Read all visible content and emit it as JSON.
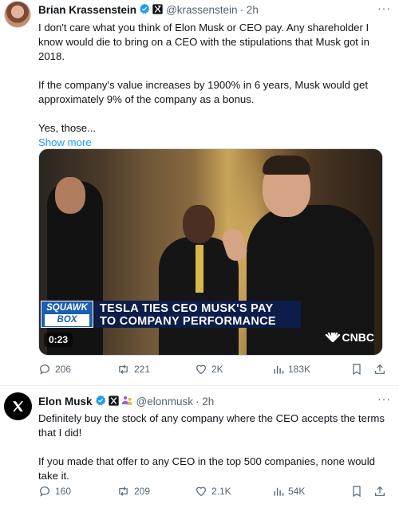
{
  "tweet1": {
    "name": "Brian Krassenstein",
    "handle": "@krassenstein",
    "time": "· 2h",
    "more": "···",
    "paragraphs": [
      "I don't care what you think of Elon Musk or CEO pay. Any shareholder I know would die to bring on a CEO with the stipulations that Musk got in 2018.",
      "If the company's value increases by 1900% in 6 years, Musk would get approximately 9% of the company as a bonus.",
      "Yes, those..."
    ],
    "show_more": "Show more",
    "video": {
      "duration": "0:23",
      "squawk_line1": "SQUAWK",
      "squawk_line2": "BOX",
      "headline_line1": "TESLA TIES CEO MUSK'S PAY",
      "headline_line2": "TO COMPANY PERFORMANCE",
      "network": "CNBC"
    },
    "stats": {
      "replies": "206",
      "reposts": "221",
      "likes": "2K",
      "views": "183K"
    }
  },
  "tweet2": {
    "name": "Elon Musk",
    "handle": "@elonmusk",
    "time": "· 2h",
    "more": "···",
    "paragraphs": [
      "Definitely buy the stock of any company where the CEO accepts the terms that I did!",
      "If you made that offer to any CEO in the top 500 companies, none would take it."
    ],
    "stats": {
      "replies": "160",
      "reposts": "209",
      "likes": "2.1K",
      "views": "54K"
    }
  },
  "colors": {
    "accent": "#1d9bf0",
    "muted": "#536471",
    "text": "#0f1419",
    "gold_badge": "#e2b719"
  },
  "icons": [
    "verified-badge-icon",
    "affiliate-badge-icon",
    "reply-icon",
    "repost-icon",
    "like-icon",
    "views-icon",
    "bookmark-icon",
    "share-icon",
    "x-logo-icon"
  ]
}
